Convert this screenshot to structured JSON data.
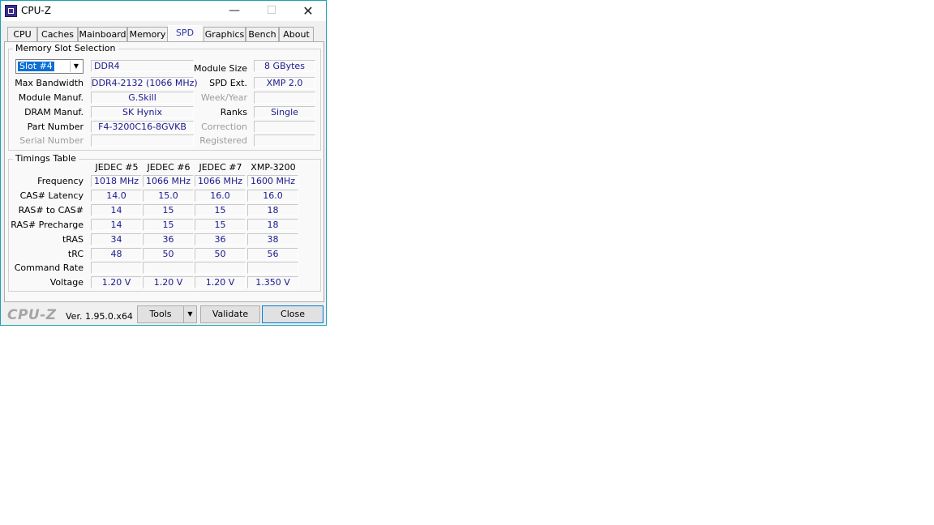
{
  "window": {
    "title": "CPU-Z"
  },
  "tabs": [
    {
      "label": "CPU"
    },
    {
      "label": "Caches"
    },
    {
      "label": "Mainboard"
    },
    {
      "label": "Memory"
    },
    {
      "label": "SPD",
      "active": true
    },
    {
      "label": "Graphics"
    },
    {
      "label": "Bench"
    },
    {
      "label": "About"
    }
  ],
  "slot": {
    "group_title": "Memory Slot Selection",
    "selected": "Slot #4",
    "type": "DDR4",
    "labels": {
      "max_bandwidth": "Max Bandwidth",
      "module_manuf": "Module Manuf.",
      "dram_manuf": "DRAM Manuf.",
      "part_number": "Part Number",
      "serial_number": "Serial Number",
      "module_size": "Module Size",
      "spd_ext": "SPD Ext.",
      "week_year": "Week/Year",
      "ranks": "Ranks",
      "correction": "Correction",
      "registered": "Registered"
    },
    "values": {
      "max_bandwidth": "DDR4-2132 (1066 MHz)",
      "module_manuf": "G.Skill",
      "dram_manuf": "SK Hynix",
      "part_number": "F4-3200C16-8GVKB",
      "serial_number": "",
      "module_size": "8 GBytes",
      "spd_ext": "XMP 2.0",
      "week_year": "",
      "ranks": "Single",
      "correction": "",
      "registered": ""
    }
  },
  "timings": {
    "group_title": "Timings Table",
    "columns": [
      "JEDEC #5",
      "JEDEC #6",
      "JEDEC #7",
      "XMP-3200"
    ],
    "rows": [
      {
        "label": "Frequency",
        "values": [
          "1018 MHz",
          "1066 MHz",
          "1066 MHz",
          "1600 MHz"
        ]
      },
      {
        "label": "CAS# Latency",
        "values": [
          "14.0",
          "15.0",
          "16.0",
          "16.0"
        ]
      },
      {
        "label": "RAS# to CAS#",
        "values": [
          "14",
          "15",
          "15",
          "18"
        ]
      },
      {
        "label": "RAS# Precharge",
        "values": [
          "14",
          "15",
          "15",
          "18"
        ]
      },
      {
        "label": "tRAS",
        "values": [
          "34",
          "36",
          "36",
          "38"
        ]
      },
      {
        "label": "tRC",
        "values": [
          "48",
          "50",
          "50",
          "56"
        ]
      },
      {
        "label": "Command Rate",
        "values": [
          "",
          "",
          "",
          ""
        ]
      },
      {
        "label": "Voltage",
        "values": [
          "1.20 V",
          "1.20 V",
          "1.20 V",
          "1.350 V"
        ]
      }
    ]
  },
  "footer": {
    "logo": "CPU-Z",
    "version": "Ver. 1.95.0.x64",
    "tools_label": "Tools",
    "validate_label": "Validate",
    "close_label": "Close"
  }
}
